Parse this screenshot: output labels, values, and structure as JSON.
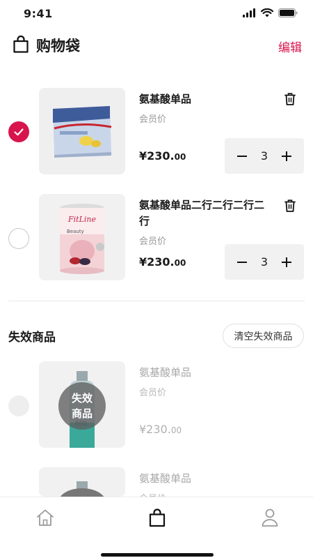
{
  "status": {
    "time": "9:41"
  },
  "header": {
    "title": "购物袋",
    "edit_label": "编辑"
  },
  "cart_items": [
    {
      "name": "氨基酸单品",
      "member_label": "会员价",
      "price_main": "¥230.",
      "price_cents": "00",
      "quantity": "3",
      "selected": true
    },
    {
      "name": "氨基酸单品二行二行二行二行",
      "member_label": "会员价",
      "price_main": "¥230.",
      "price_cents": "00",
      "quantity": "3",
      "selected": false
    }
  ],
  "invalid_section": {
    "title": "失效商品",
    "clear_label": "清空失效商品",
    "badge_line1": "失效",
    "badge_line2": "商品",
    "items": [
      {
        "name": "氨基酸单品",
        "member_label": "会员价",
        "price_main": "¥230.",
        "price_cents": "00"
      },
      {
        "name": "氨基酸单品",
        "member_label": "会员价"
      }
    ]
  },
  "tabbar": {
    "items": [
      "home-icon",
      "bag-icon",
      "user-icon"
    ],
    "active": "bag-icon"
  },
  "colors": {
    "accent": "#d8144d",
    "muted": "#9a9a9a",
    "panel": "#f1f1f1"
  }
}
